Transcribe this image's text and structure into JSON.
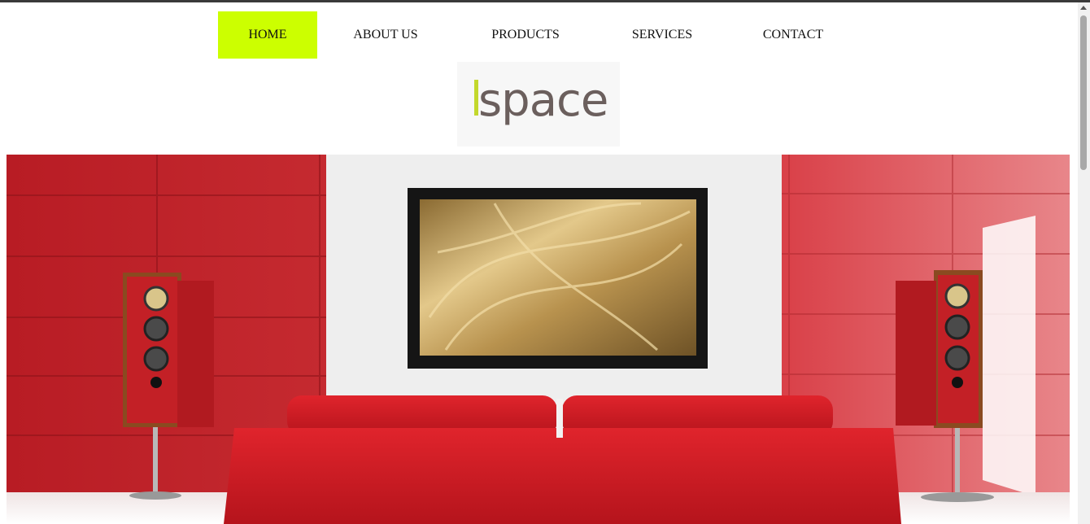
{
  "nav": {
    "items": [
      {
        "label": "HOME"
      },
      {
        "label": "ABOUT US"
      },
      {
        "label": "PRODUCTS"
      },
      {
        "label": "SERVICES"
      },
      {
        "label": "CONTACT"
      }
    ],
    "active_color": "#ccff00"
  },
  "logo": {
    "text": "space",
    "bar_color": "#c3d82d",
    "text_color": "#6b5f5d"
  },
  "hero": {
    "image": "red-living-room-with-tv-speakers-and-sofa"
  }
}
